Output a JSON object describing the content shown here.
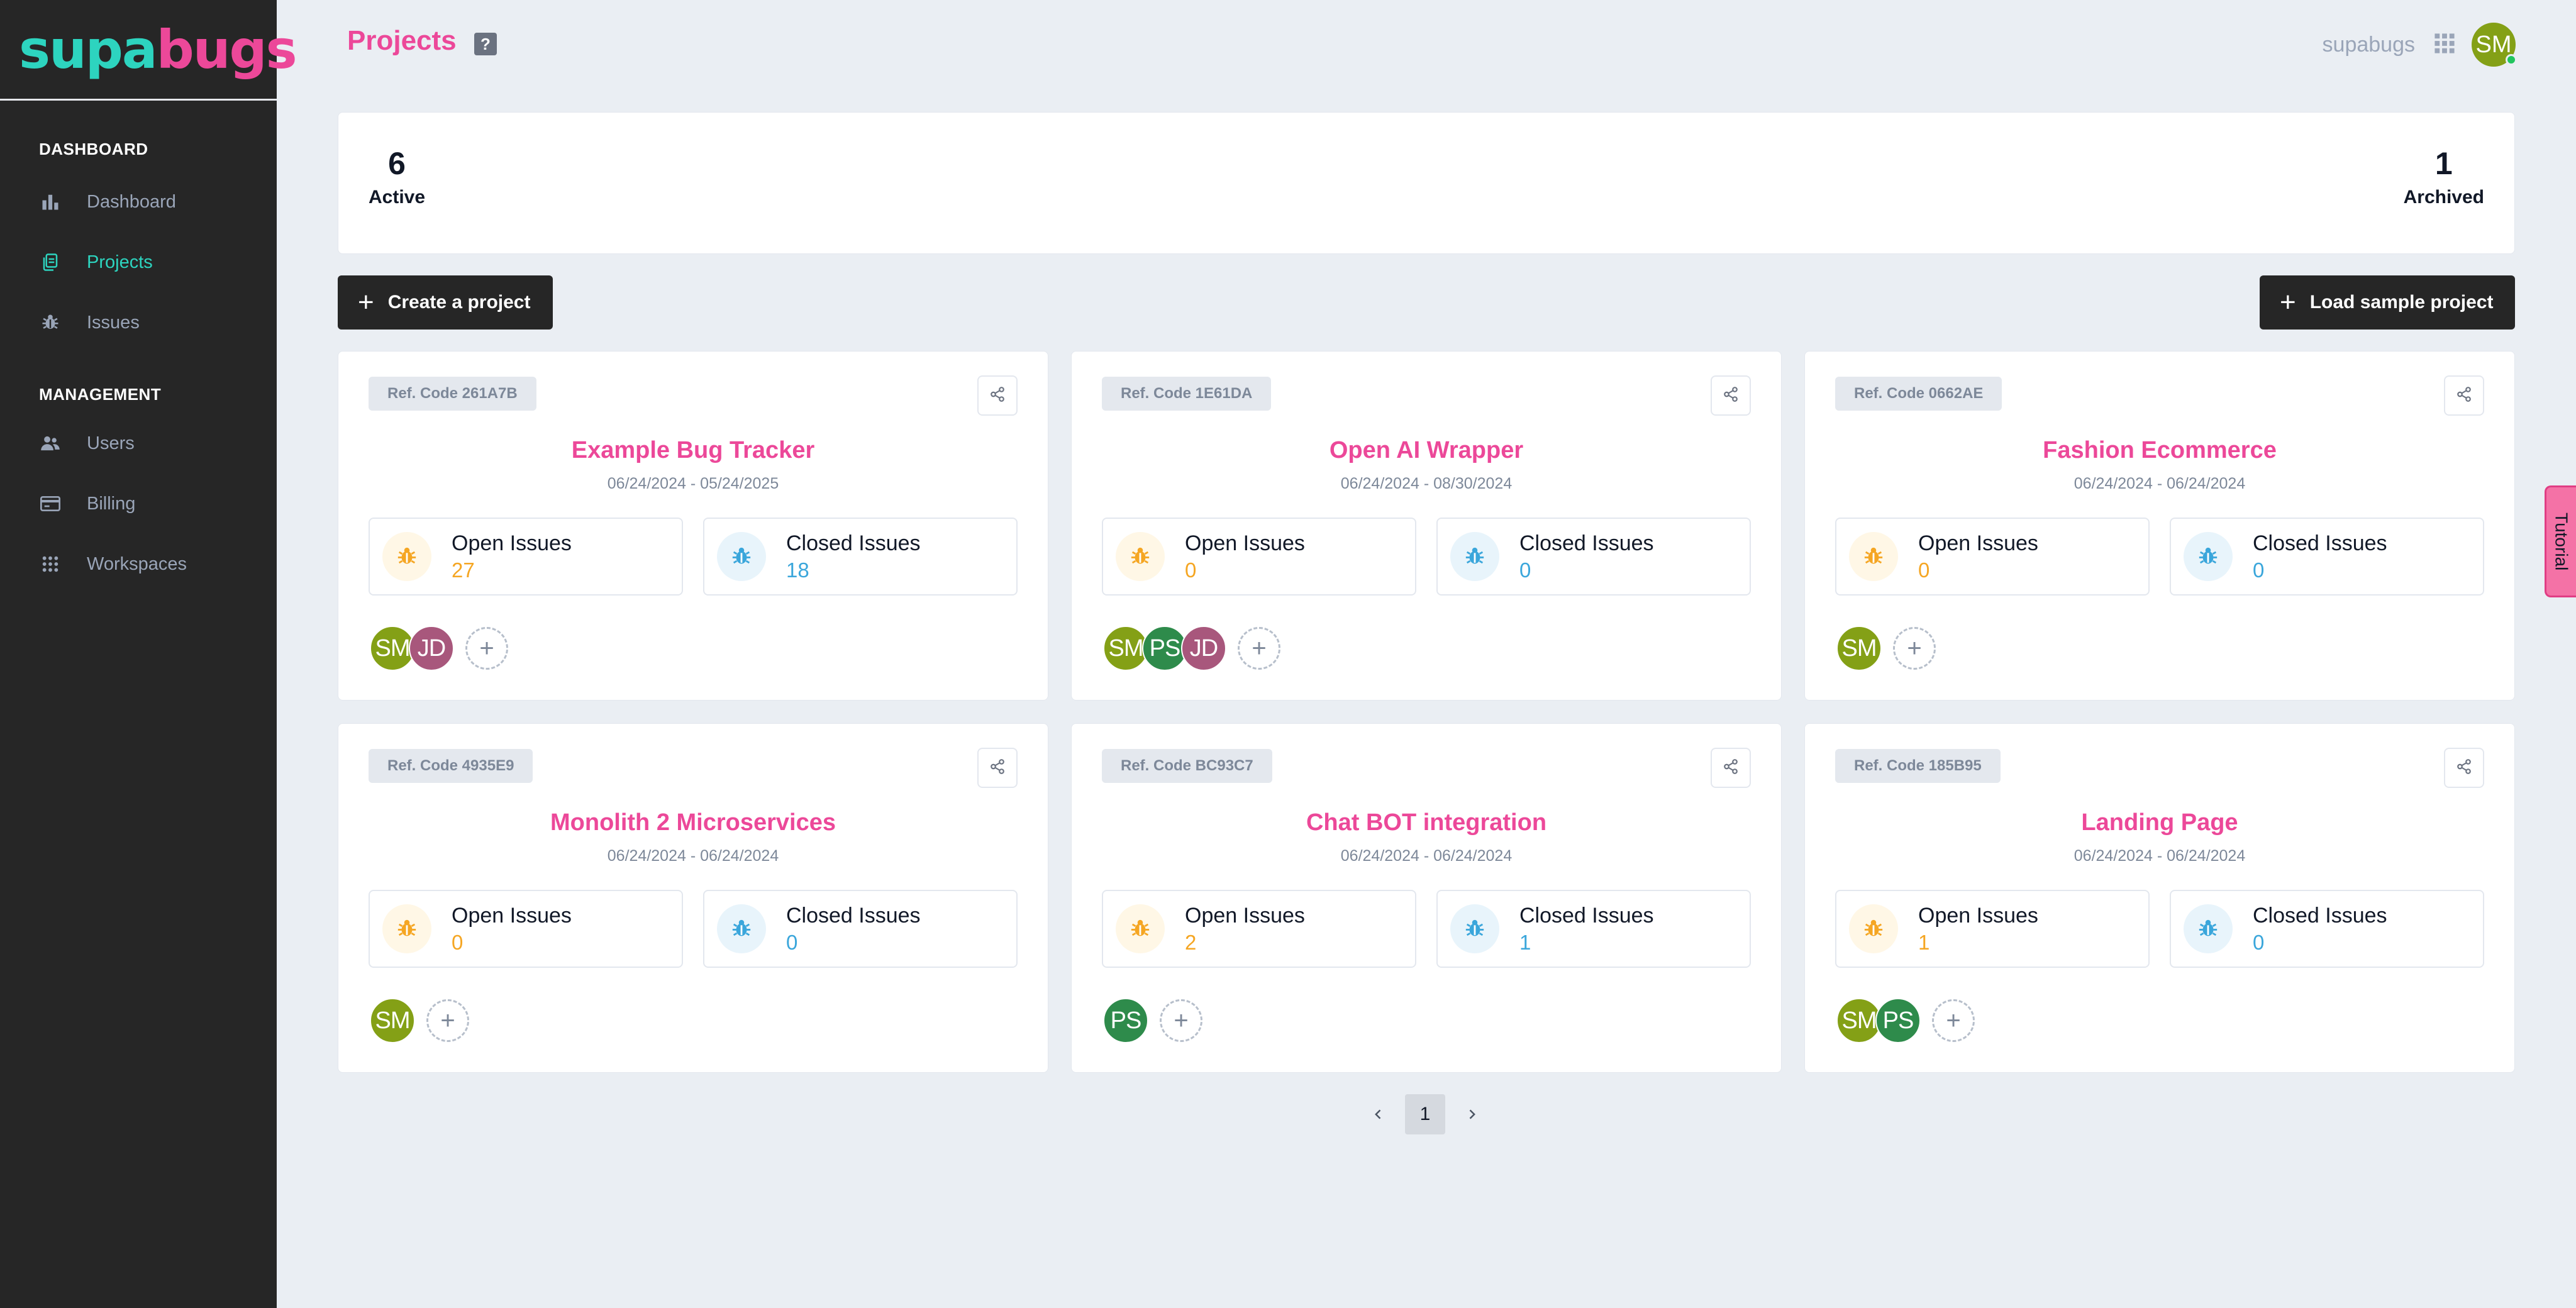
{
  "brand": {
    "part1": "supa",
    "part2": "bugs"
  },
  "sidebar": {
    "sections": [
      {
        "title": "DASHBOARD",
        "items": [
          {
            "label": "Dashboard",
            "icon": "bar-chart-icon"
          },
          {
            "label": "Projects",
            "icon": "documents-icon",
            "active": true
          },
          {
            "label": "Issues",
            "icon": "bug-icon"
          }
        ]
      },
      {
        "title": "MANAGEMENT",
        "items": [
          {
            "label": "Users",
            "icon": "users-icon"
          },
          {
            "label": "Billing",
            "icon": "credit-card-icon"
          },
          {
            "label": "Workspaces",
            "icon": "grid-icon"
          }
        ]
      }
    ]
  },
  "header": {
    "title": "Projects",
    "help": "?",
    "workspace": "supabugs",
    "user_initials": "SM"
  },
  "stats": {
    "active": {
      "value": "6",
      "label": "Active"
    },
    "archived": {
      "value": "1",
      "label": "Archived"
    }
  },
  "actions": {
    "create": "Create a project",
    "sample": "Load sample project"
  },
  "labels": {
    "open_issues": "Open Issues",
    "closed_issues": "Closed Issues"
  },
  "projects": [
    {
      "ref": "Ref. Code 261A7B",
      "name": "Example Bug Tracker",
      "dates": "06/24/2024 - 05/24/2025",
      "open": "27",
      "closed": "18",
      "members": [
        "SM",
        "JD"
      ]
    },
    {
      "ref": "Ref. Code 1E61DA",
      "name": "Open AI Wrapper",
      "dates": "06/24/2024 - 08/30/2024",
      "open": "0",
      "closed": "0",
      "members": [
        "SM",
        "PS",
        "JD"
      ]
    },
    {
      "ref": "Ref. Code 0662AE",
      "name": "Fashion Ecommerce",
      "dates": "06/24/2024 - 06/24/2024",
      "open": "0",
      "closed": "0",
      "members": [
        "SM"
      ]
    },
    {
      "ref": "Ref. Code 4935E9",
      "name": "Monolith 2 Microservices",
      "dates": "06/24/2024 - 06/24/2024",
      "open": "0",
      "closed": "0",
      "members": [
        "SM"
      ]
    },
    {
      "ref": "Ref. Code BC93C7",
      "name": "Chat BOT integration",
      "dates": "06/24/2024 - 06/24/2024",
      "open": "2",
      "closed": "1",
      "members": [
        "PS"
      ]
    },
    {
      "ref": "Ref. Code 185B95",
      "name": "Landing Page",
      "dates": "06/24/2024 - 06/24/2024",
      "open": "1",
      "closed": "0",
      "members": [
        "SM",
        "PS"
      ]
    }
  ],
  "pagination": {
    "current": "1"
  },
  "tutorial": "Tutorial",
  "colors": {
    "accent_pink": "#ec4899",
    "accent_teal": "#2dd4bf",
    "open_issue": "#f5a623",
    "closed_issue": "#3aa6db",
    "sidebar_bg": "#262626"
  }
}
